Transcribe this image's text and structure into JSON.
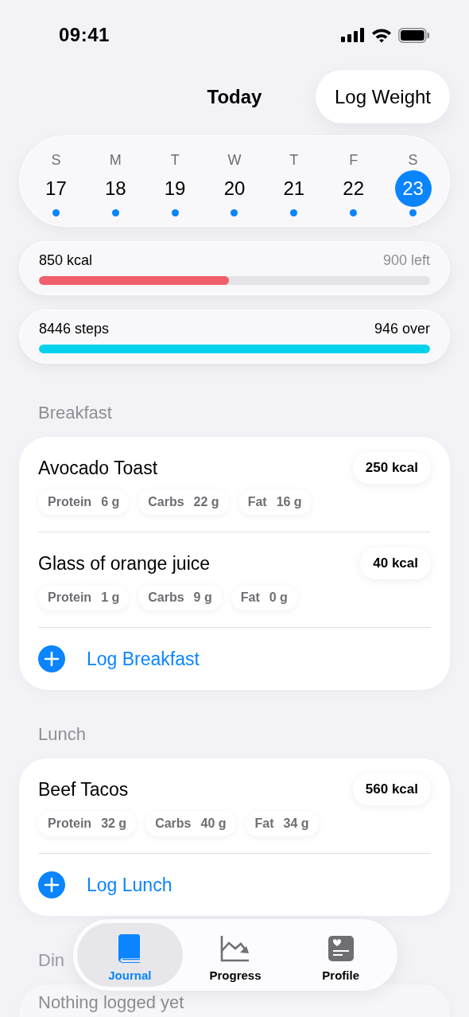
{
  "status_bar": {
    "time": "09:41"
  },
  "header": {
    "title": "Today",
    "action": "Log Weight"
  },
  "week": [
    {
      "weekday": "S",
      "date": "17",
      "selected": false,
      "logged": true
    },
    {
      "weekday": "M",
      "date": "18",
      "selected": false,
      "logged": true
    },
    {
      "weekday": "T",
      "date": "19",
      "selected": false,
      "logged": true
    },
    {
      "weekday": "W",
      "date": "20",
      "selected": false,
      "logged": true
    },
    {
      "weekday": "T",
      "date": "21",
      "selected": false,
      "logged": true
    },
    {
      "weekday": "F",
      "date": "22",
      "selected": false,
      "logged": true
    },
    {
      "weekday": "S",
      "date": "23",
      "selected": true,
      "logged": true
    }
  ],
  "goals": [
    {
      "label": "850 kcal",
      "remaining": "900 left",
      "exceeded": false,
      "level": 0.485,
      "color": "#f25f6c"
    },
    {
      "label": "8446 steps",
      "remaining": "946 over",
      "exceeded": true,
      "level": 1,
      "color": "#00d2ee"
    }
  ],
  "meals": [
    {
      "title": "Breakfast",
      "dimmed": false,
      "entries": [
        {
          "name": "Avocado Toast",
          "calories": "250 kcal",
          "macros": [
            {
              "label": "Protein",
              "value": "6 g"
            },
            {
              "label": "Carbs",
              "value": "22 g"
            },
            {
              "label": "Fat",
              "value": "16 g"
            }
          ]
        },
        {
          "name": "Glass of orange juice",
          "calories": "40 kcal",
          "macros": [
            {
              "label": "Protein",
              "value": "1 g"
            },
            {
              "label": "Carbs",
              "value": "9 g"
            },
            {
              "label": "Fat",
              "value": "0 g"
            }
          ]
        }
      ],
      "action": "Log Breakfast"
    },
    {
      "title": "Lunch",
      "dimmed": false,
      "entries": [
        {
          "name": "Beef Tacos",
          "calories": "560 kcal",
          "macros": [
            {
              "label": "Protein",
              "value": "32 g"
            },
            {
              "label": "Carbs",
              "value": "40 g"
            },
            {
              "label": "Fat",
              "value": "34 g"
            }
          ]
        }
      ],
      "action": "Log Lunch"
    },
    {
      "title": "Din",
      "dimmed": true,
      "empty_text": "Nothing logged yet"
    }
  ],
  "tabs": [
    {
      "label": "Journal",
      "kind": "book",
      "selected": true
    },
    {
      "label": "Progress",
      "kind": "chart",
      "selected": false
    },
    {
      "label": "Profile",
      "kind": "profile",
      "selected": false
    }
  ]
}
